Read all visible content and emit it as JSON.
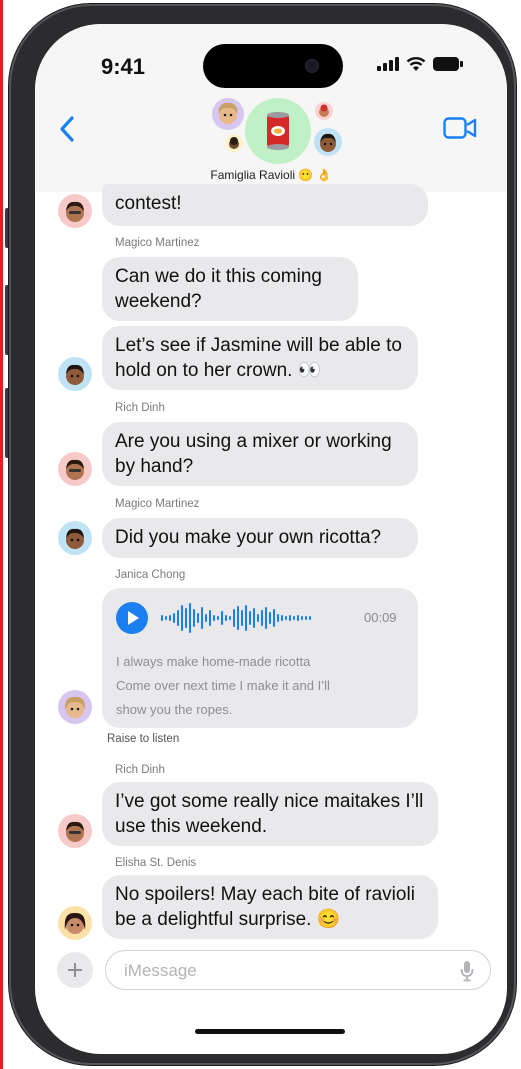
{
  "status_bar": {
    "time": "9:41"
  },
  "header": {
    "group_name": "Famiglia Ravioli 😶 👌"
  },
  "messages": [
    {
      "text": "contest!"
    },
    {
      "sender": "Magico Martinez",
      "text": "Can we do it this coming weekend?"
    },
    {
      "text": "Let’s see if Jasmine will be able to hold on to her crown. 👀"
    },
    {
      "sender": "Rich Dinh",
      "text": "Are you using a mixer or working by hand?"
    },
    {
      "sender": "Magico Martinez",
      "text": "Did you make your own ricotta?"
    },
    {
      "sender": "Janica Chong"
    },
    {
      "sender": "Rich Dinh",
      "text": "I’ve got some really nice maitakes I’ll use this weekend."
    },
    {
      "sender": "Elisha St. Denis",
      "text": "No spoilers! May each bite of ravioli be a delightful surprise. 😊"
    }
  ],
  "audio": {
    "duration": "00:09",
    "transcript": [
      "I always make home-made ricotta",
      "Come over next time I make it and I’ll",
      "show you the ropes."
    ],
    "hint": "Raise to listen"
  },
  "composer": {
    "placeholder": "iMessage"
  },
  "icons": [
    "back-chevron-icon",
    "video-camera-icon",
    "signal-icon",
    "wifi-icon",
    "battery-icon",
    "play-icon",
    "plus-icon",
    "microphone-icon"
  ],
  "colors": {
    "accent": "#1a7ff0",
    "bubble": "#e9e9eb"
  }
}
